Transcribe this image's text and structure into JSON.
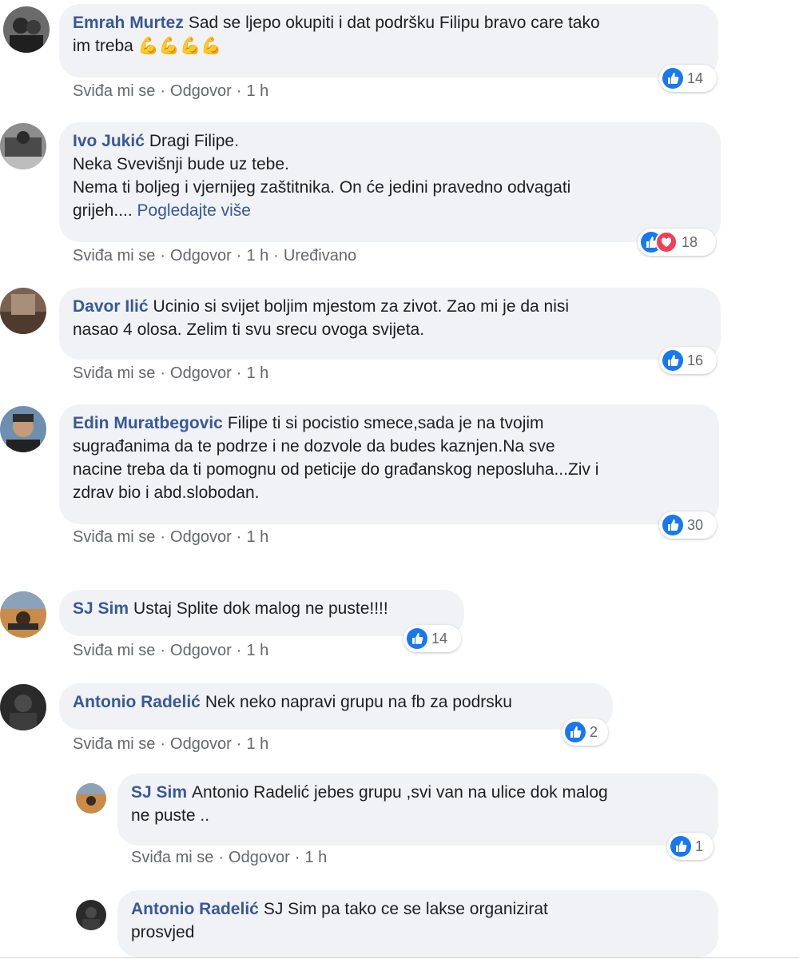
{
  "actions": {
    "like": "Sviđa mi se",
    "reply": "Odgovor",
    "dot": "·",
    "edited": "Uređivano"
  },
  "colors": {
    "author": "#385898",
    "bubble": "#f0f2f5",
    "like": "#1877f2",
    "love": "#f33e58"
  },
  "comments": [
    {
      "author": "Emrah Murtez",
      "text": "Sad se ljepo okupiti i dat podršku Filipu bravo care tako\nim treba",
      "emoji": "💪💪💪💪",
      "time": "1 h",
      "reactions": [
        "like-icon"
      ],
      "count": "14"
    },
    {
      "author": "Ivo Jukić",
      "text": "Dragi Filipe.\nNeka Svevišnji bude uz tebe.\nNema ti boljeg i vjernijeg zaštitnika. On će jedini pravedno odvagati\ngrijeh....",
      "see_more": "Pogledajte više",
      "time": "1 h",
      "edited": true,
      "reactions": [
        "like-icon",
        "love-icon"
      ],
      "count": "18"
    },
    {
      "author": "Davor Ilić",
      "text": "Ucinio si svijet boljim mjestom za zivot. Zao mi je da nisi\nnasao 4 olosa. Zelim ti svu srecu ovoga svijeta.",
      "time": "1 h",
      "reactions": [
        "like-icon"
      ],
      "count": "16"
    },
    {
      "author": "Edin Muratbegovic",
      "text": "Filipe ti si pocistio smece,sada je na tvojim\nsugrađanima da te podrze i ne dozvole da budes kaznjen.Na sve\nnacine treba da ti pomognu od peticije do građanskog neposluha...Ziv i\nzdrav bio i abd.slobodan.",
      "time": "1 h",
      "reactions": [
        "like-icon"
      ],
      "count": "30"
    },
    {
      "author": "SJ Sim",
      "text": "Ustaj Splite dok malog ne puste!!!!",
      "time": "1 h",
      "reactions": [
        "like-icon"
      ],
      "count": "14"
    },
    {
      "author": "Antonio Radelić",
      "text": "Nek neko napravi grupu na fb za podrsku",
      "time": "1 h",
      "reactions": [
        "like-icon"
      ],
      "count": "2"
    },
    {
      "author": "SJ Sim",
      "text": "Antonio Radelić jebes grupu ,svi van na ulice dok malog\nne puste ..",
      "time": "1 h",
      "reactions": [
        "like-icon"
      ],
      "count": "1"
    },
    {
      "author": "Antonio Radelić",
      "text": "SJ Sim pa tako ce se lakse organizirat\nprosvjed"
    }
  ]
}
